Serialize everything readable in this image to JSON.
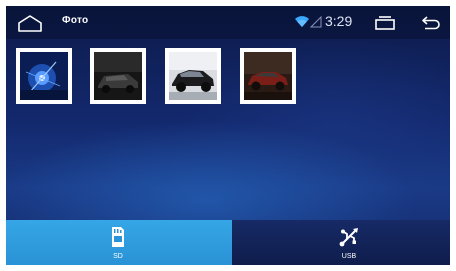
{
  "statusbar": {
    "home_icon": "home-icon",
    "title": "Фото",
    "wifi_icon": "wifi-icon",
    "signal_icon": "signal-icon",
    "time": "3:29",
    "recents_icon": "recent-apps-icon",
    "back_icon": "back-icon"
  },
  "gallery": {
    "thumbnails": [
      {
        "subject": "blue-light-photo"
      },
      {
        "subject": "dark-car-photo"
      },
      {
        "subject": "black-car-photo"
      },
      {
        "subject": "red-car-photo"
      }
    ]
  },
  "storage_tabs": [
    {
      "label": "SD",
      "icon": "sd-card-icon",
      "selected": true
    },
    {
      "label": "USB",
      "icon": "usb-icon",
      "selected": false
    }
  ],
  "colors": {
    "accent": "#2a9be0",
    "background": "#13296e",
    "wifi": "#3aa8ff",
    "text": "#ffffff"
  }
}
